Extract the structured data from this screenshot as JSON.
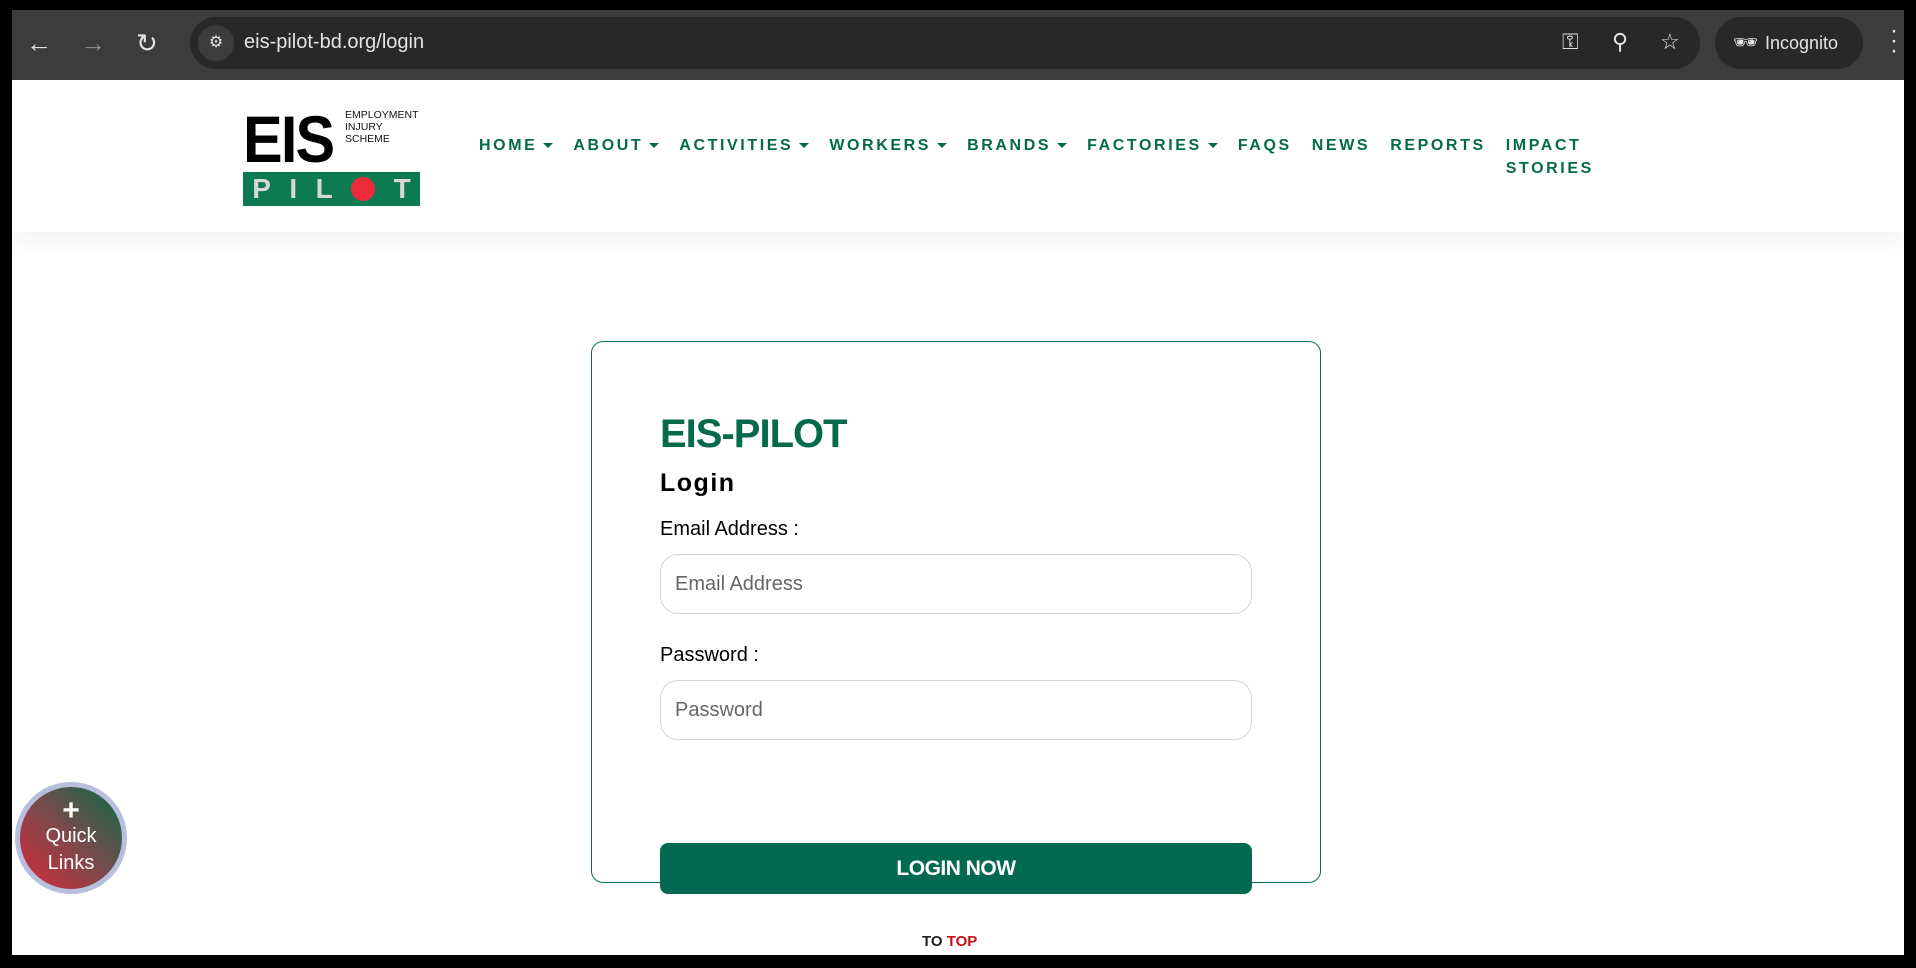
{
  "browser": {
    "url": "eis-pilot-bd.org/login",
    "incognito_label": "Incognito"
  },
  "logo": {
    "eis": "EIS",
    "line1": "EMPLOYMENT",
    "line2": "INJURY",
    "line3": "SCHEME",
    "pilot": [
      "P",
      "I",
      "L",
      "T"
    ]
  },
  "nav": [
    {
      "label": "HOME",
      "dropdown": true
    },
    {
      "label": "ABOUT",
      "dropdown": true
    },
    {
      "label": "ACTIVITIES",
      "dropdown": true
    },
    {
      "label": "WORKERS",
      "dropdown": true
    },
    {
      "label": "BRANDS",
      "dropdown": true
    },
    {
      "label": "FACTORIES",
      "dropdown": true
    },
    {
      "label": "FAQS",
      "dropdown": false
    },
    {
      "label": "NEWS",
      "dropdown": false
    },
    {
      "label": "REPORTS",
      "dropdown": false
    },
    {
      "label": "IMPACT STORIES",
      "line1": "IMPACT",
      "line2": "STORIES",
      "dropdown": false
    }
  ],
  "login": {
    "title": "EIS-PILOT",
    "subtitle": "Login",
    "email_label": "Email Address :",
    "email_placeholder": "Email Address",
    "password_label": "Password :",
    "password_placeholder": "Password",
    "button": "LOGIN NOW"
  },
  "quick_links": {
    "plus": "+",
    "line1": "Quick",
    "line2": "Links"
  },
  "to_top": {
    "part1": "TO",
    "part2": "TOP"
  },
  "colors": {
    "brand_green": "#046a4f",
    "accent_red": "#c81010"
  }
}
